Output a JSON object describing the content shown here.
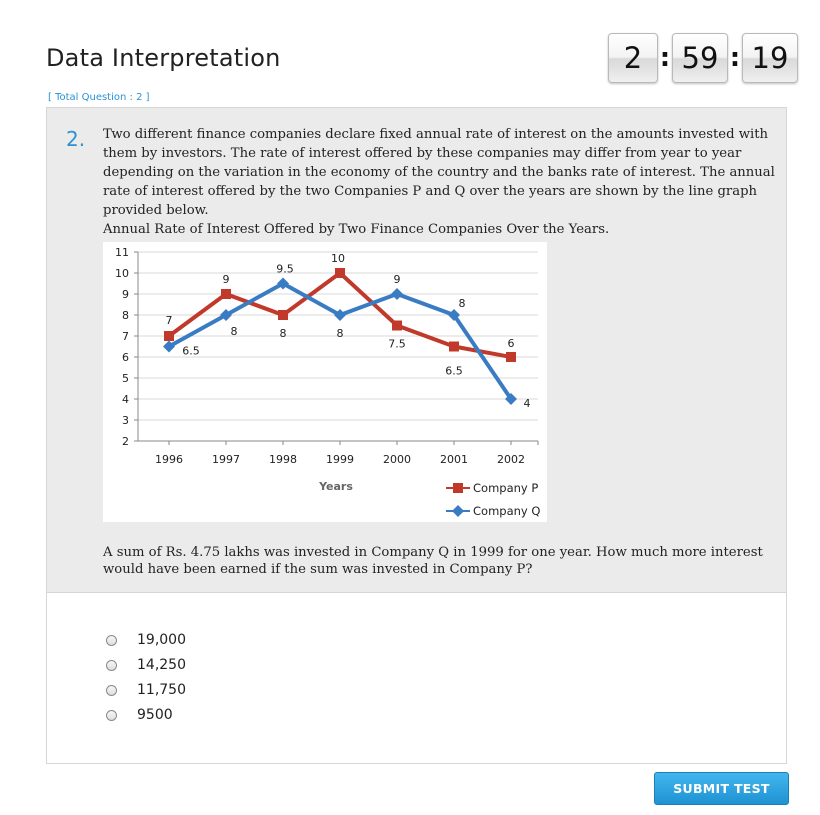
{
  "header": {
    "title": "Data Interpretation",
    "total_questions": "[ Total Question : 2 ]"
  },
  "timer": {
    "hours": "2",
    "minutes": "59",
    "seconds": "19",
    "separator": ":"
  },
  "question": {
    "number": "2.",
    "text": "Two different finance companies declare fixed annual rate of interest on the amounts invested with them by investors. The rate of interest offered by these companies may differ from year to year depending on the variation in the economy of the country and the banks rate of interest. The annual rate of interest offered by the two Companies P and Q over the years are shown by the line graph provided below.",
    "chart_title": "Annual Rate of Interest Offered by Two Finance Companies Over the Years.",
    "subquestion": "A sum of Rs. 4.75 lakhs was invested in Company Q in 1999 for one year. How much more interest would have been earned if the sum was invested in Company P?"
  },
  "options": [
    {
      "label": "19,000"
    },
    {
      "label": "14,250"
    },
    {
      "label": "11,750"
    },
    {
      "label": "9500"
    }
  ],
  "submit_label": "SUBMIT TEST",
  "chart_data": {
    "type": "line",
    "categories": [
      "1996",
      "1997",
      "1998",
      "1999",
      "2000",
      "2001",
      "2002"
    ],
    "series": [
      {
        "name": "Company P",
        "color": "#c0392b",
        "marker": "square",
        "values": [
          7,
          9,
          8,
          10,
          7.5,
          6.5,
          6
        ]
      },
      {
        "name": "Company Q",
        "color": "#3a7cc4",
        "marker": "diamond",
        "values": [
          6.5,
          8,
          9.5,
          8,
          9,
          8,
          4
        ]
      }
    ],
    "xlabel": "Years",
    "ylabel": "",
    "ylim": [
      2,
      11
    ],
    "yticks": [
      2,
      3,
      4,
      5,
      6,
      7,
      8,
      9,
      10,
      11
    ],
    "data_labels": [
      {
        "text": "7"
      },
      {
        "text": "9"
      },
      {
        "text": "9.5"
      },
      {
        "text": "10"
      },
      {
        "text": "9"
      },
      {
        "text": "8"
      },
      {
        "text": "6"
      },
      {
        "text": "6.5"
      },
      {
        "text": "8"
      },
      {
        "text": "8"
      },
      {
        "text": "8"
      },
      {
        "text": "7.5"
      },
      {
        "text": "6.5"
      },
      {
        "text": "4"
      }
    ],
    "grid": true,
    "legend_position": "bottom-right"
  }
}
